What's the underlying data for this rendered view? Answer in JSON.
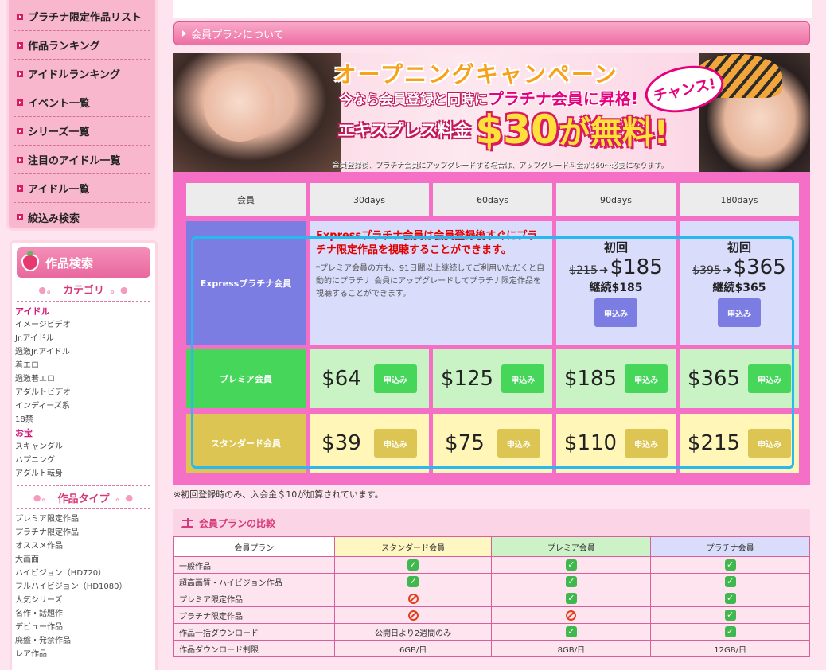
{
  "sidebar": {
    "menu": [
      "プラチナ限定作品リスト",
      "作品ランキング",
      "アイドルランキング",
      "イベント一覧",
      "シリーズ一覧",
      "注目のアイドル一覧",
      "アイドル一覧",
      "絞込み検索"
    ],
    "search_title": "作品検索",
    "category_title": "カテゴリ",
    "categories": [
      {
        "label": "アイドル",
        "strong": true
      },
      {
        "label": "イメージビデオ",
        "strong": false
      },
      {
        "label": "Jr.アイドル",
        "strong": false
      },
      {
        "label": "過激Jr.アイドル",
        "strong": false
      },
      {
        "label": "着エロ",
        "strong": false
      },
      {
        "label": "過激着エロ",
        "strong": false
      },
      {
        "label": "アダルトビデオ",
        "strong": false
      },
      {
        "label": "インディーズ系",
        "strong": false
      },
      {
        "label": "18禁",
        "strong": false
      },
      {
        "label": "お宝",
        "strong": true
      },
      {
        "label": "スキャンダル",
        "strong": false
      },
      {
        "label": "ハプニング",
        "strong": false
      },
      {
        "label": "アダルト転身",
        "strong": false
      }
    ],
    "type_title": "作品タイプ",
    "types": [
      "プレミア限定作品",
      "プラチナ限定作品",
      "オススメ作品",
      "大画面",
      "ハイビジョン（HD720）",
      "フルハイビジョン（HD1080）",
      "人気シリーズ",
      "名作・話題作",
      "デビュー作品",
      "廃盤・発禁作品",
      "レア作品"
    ]
  },
  "main": {
    "section_title": "会員プランについて",
    "banner": {
      "campaign": "オープニングキャンペーン",
      "line1_a": "今なら会員登録と同時に",
      "line1_b": "プラチナ会員に昇格!",
      "line2_a": "エキスプレス料金",
      "line2_price": "$30",
      "line2_b": "が無料!",
      "chance": "チャンス!",
      "note": "会員登録後、プラチナ会員にアップグレードする場合は、アップグレード料金が$60～必要になります。"
    },
    "plans": {
      "header_member": "会員",
      "durations": [
        "30days",
        "60days",
        "90days",
        "180days"
      ],
      "apply_label": "申込み",
      "express": {
        "label": "Expressプラチナ会員",
        "desc_red": "Expressプラチナ会員は会員登録後すぐにプラチナ限定作品を視聴することができます。",
        "desc_note": "*プレミア会員の方も、91日間以上継続してご利用いただくと自動的にプラチナ 会員にアップグレードしてプラチナ限定作品を視聴することができます。",
        "first_label": "初回",
        "cont_label_90": "継続$185",
        "cont_label_180": "継続$365",
        "old_90": "$215",
        "new_90": "$185",
        "old_180": "$395",
        "new_180": "$365"
      },
      "premier": {
        "label": "プレミア会員",
        "prices": [
          "$64",
          "$125",
          "$185",
          "$365"
        ]
      },
      "standard": {
        "label": "スタンダード会員",
        "prices": [
          "$39",
          "$75",
          "$110",
          "$215"
        ]
      }
    },
    "fee_note": "※初回登録時のみ、入会金＄10が加算されています。",
    "comparison": {
      "title": "会員プランの比較",
      "headers": [
        "会員プラン",
        "スタンダード会員",
        "プレミア会員",
        "プラチナ会員"
      ],
      "rows": [
        {
          "label": "一般作品",
          "std": "ok",
          "pre": "ok",
          "pla": "ok"
        },
        {
          "label": "超高画質・ハイビジョン作品",
          "std": "ok",
          "pre": "ok",
          "pla": "ok"
        },
        {
          "label": "プレミア限定作品",
          "std": "ng",
          "pre": "ok",
          "pla": "ok"
        },
        {
          "label": "プラチナ限定作品",
          "std": "ng",
          "pre": "ng",
          "pla": "ok"
        },
        {
          "label": "作品一括ダウンロード",
          "std": "公開日より2週間のみ",
          "pre": "ok",
          "pla": "ok"
        },
        {
          "label": "作品ダウンロード制限",
          "std": "6GB/日",
          "pre": "8GB/日",
          "pla": "12GB/日"
        }
      ]
    }
  }
}
